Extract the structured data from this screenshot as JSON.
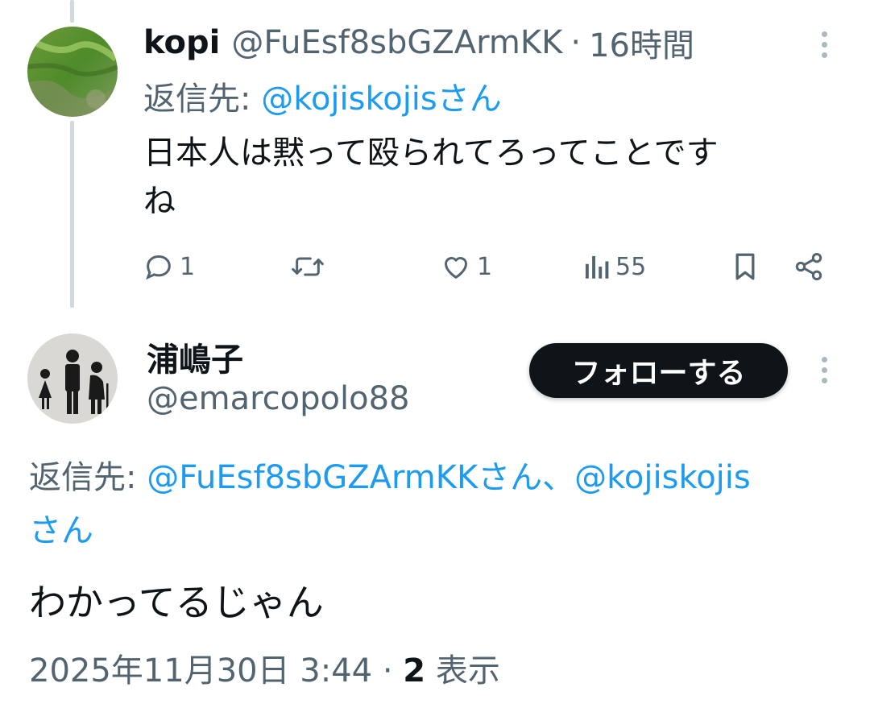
{
  "reply_tweet": {
    "author_name": "kopi",
    "author_handle": "@FuEsf8sbGZArmKK",
    "separator": "·",
    "time_ago": "16時間",
    "reply_prefix": "返信先:",
    "reply_to": "@kojiskojisさん",
    "text_line1": "日本人は黙って殴られてろってことです",
    "text_line2": "ね",
    "actions": {
      "reply_count": "1",
      "like_count": "1",
      "view_count": "55"
    }
  },
  "main_tweet": {
    "author_name": "浦嶋子",
    "author_handle": "@emarcopolo88",
    "follow_label": "フォローする",
    "reply_prefix": "返信先:",
    "reply_to_line1": "@FuEsf8sbGZArmKKさん、@kojiskojis",
    "reply_to_line2": "さん",
    "text": "わかってるじゃん",
    "timestamp": "2025年11月30日 3:44",
    "separator": "·",
    "view_count": "2",
    "view_label": "表示"
  },
  "colors": {
    "link": "#1d9bf0",
    "muted": "#536471",
    "text": "#0f1419",
    "thread_line": "#cfd9de",
    "button_bg": "#0f1419"
  },
  "icons": [
    "reply-icon",
    "retweet-icon",
    "like-icon",
    "views-icon",
    "bookmark-icon",
    "share-icon",
    "more-icon"
  ]
}
